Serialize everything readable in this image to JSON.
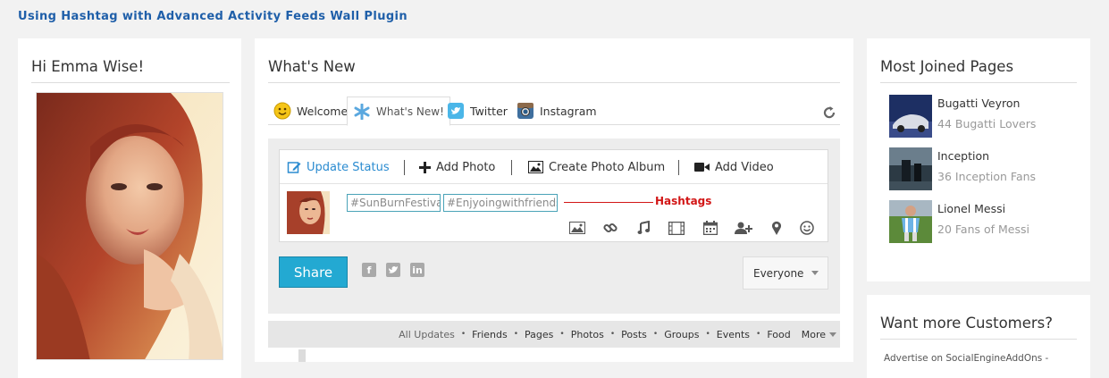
{
  "page_title": "Using Hashtag with Advanced Activity Feeds Wall Plugin",
  "profile": {
    "greeting": "Hi Emma Wise!"
  },
  "center": {
    "title": "What's New",
    "tabs": [
      {
        "label": "Welcome",
        "icon": "smiley-icon"
      },
      {
        "label": "What's New!",
        "icon": "asterisk-icon"
      },
      {
        "label": "Twitter",
        "icon": "twitter-icon"
      },
      {
        "label": "Instagram",
        "icon": "instagram-icon"
      }
    ],
    "composer": {
      "actions": [
        {
          "label": "Update Status",
          "icon": "edit-icon"
        },
        {
          "label": "Add Photo",
          "icon": "plus-icon"
        },
        {
          "label": "Create Photo Album",
          "icon": "image-icon"
        },
        {
          "label": "Add Video",
          "icon": "video-camera-icon"
        }
      ],
      "hashtags": [
        "#SunBurnFestival",
        "#Enjyoingwithfriends"
      ],
      "annotation": "Hashtags",
      "share_label": "Share",
      "privacy_value": "Everyone"
    },
    "filters": [
      "All Updates",
      "Friends",
      "Pages",
      "Photos",
      "Posts",
      "Groups",
      "Events",
      "Food"
    ],
    "more_label": "More"
  },
  "most_joined": {
    "title": "Most Joined Pages",
    "items": [
      {
        "name": "Bugatti Veyron",
        "count": "44 Bugatti Lovers"
      },
      {
        "name": "Inception",
        "count": "36 Inception Fans"
      },
      {
        "name": "Lionel Messi",
        "count": "20 Fans of Messi"
      }
    ]
  },
  "ads": {
    "title": "Want more Customers?",
    "text": "Advertise on SocialEngineAddOns -"
  },
  "colors": {
    "accent": "#23a9d2",
    "title_blue": "#1f5fa9",
    "annotation_red": "#d21616"
  }
}
